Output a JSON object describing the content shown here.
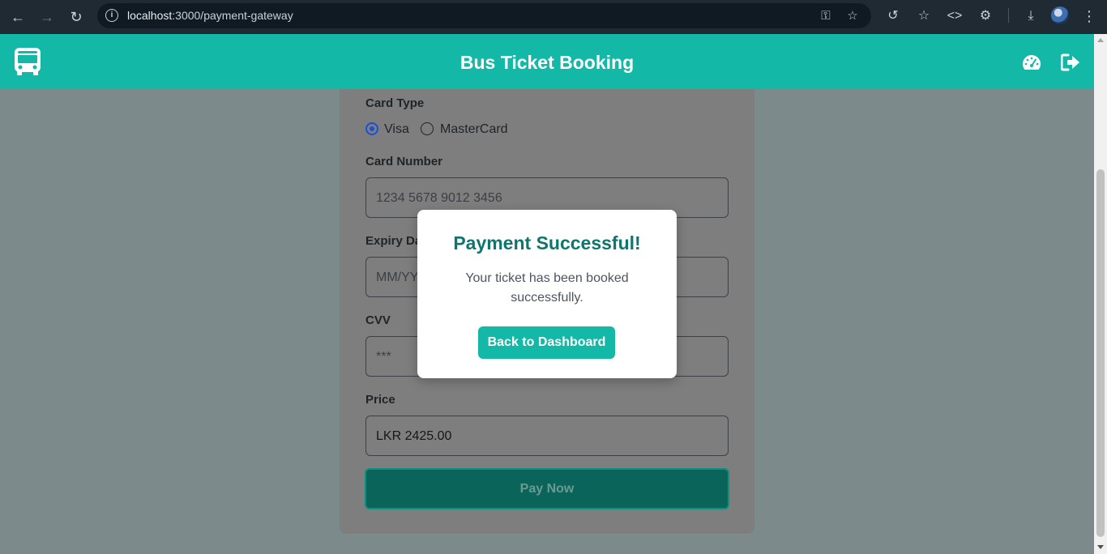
{
  "browser": {
    "url_host": "localhost",
    "url_path": ":3000/payment-gateway"
  },
  "header": {
    "title": "Bus Ticket Booking",
    "icons": [
      "bus-icon",
      "dashboard-icon",
      "logout-icon"
    ]
  },
  "form": {
    "card_type_label": "Card Type",
    "card_type_options": [
      "Visa",
      "MasterCard"
    ],
    "card_type_selected": "Visa",
    "card_number_label": "Card Number",
    "card_number_placeholder": "1234 5678 9012 3456",
    "expiry_label": "Expiry Date",
    "expiry_placeholder": "MM/YY",
    "cvv_label": "CVV",
    "cvv_placeholder": "***",
    "price_label": "Price",
    "price_value": "LKR 2425.00",
    "pay_button": "Pay Now"
  },
  "modal": {
    "title": "Payment Successful!",
    "message": "Your ticket has been booked successfully.",
    "button": "Back to Dashboard"
  },
  "colors": {
    "accent": "#14b8a6",
    "modal_title": "#0f766e",
    "pay_button": "#0b6459"
  }
}
